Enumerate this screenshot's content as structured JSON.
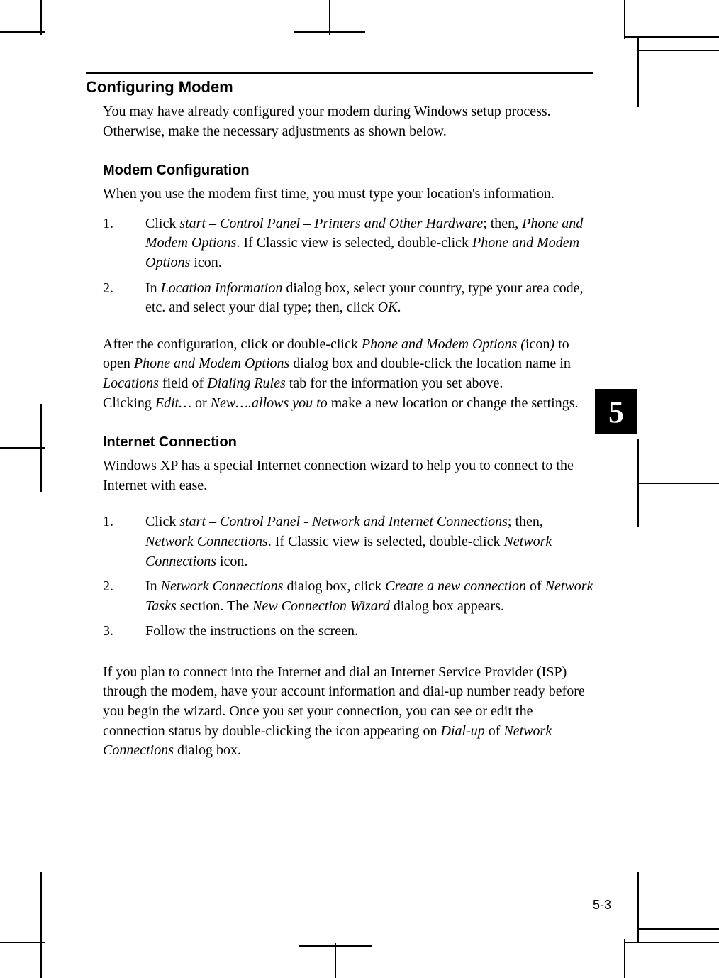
{
  "chapter_tab": "5",
  "page_number": "5-3",
  "h1": "Configuring Modem",
  "intro": "You may have already configured your modem during Windows setup process. Otherwise, make the necessary adjustments as shown below.",
  "sections": {
    "modem": {
      "title": "Modem Configuration",
      "lead": "When you use the modem first time, you must type your location's information.",
      "steps": [
        {
          "num": "1.",
          "html": "Click <i>start – Control Panel – Printers and Other Hardware</i>; then, <i>Phone and Modem Options</i>. If Classic view is selected, double-click <i>Phone and Modem Options</i> icon."
        },
        {
          "num": "2.",
          "html": "In <i>Location Information</i> dialog box, select your country, type your area code, etc. and select your dial type; then, click <i>OK</i>."
        }
      ],
      "after_html": "After the configuration, click or double-click <i>Phone and Modem Options (</i>icon<i>)</i> to open <i>Phone and Modem Options</i> dialog box and double-click the location name in <i>Locations</i> field of <i>Dialing Rules</i> tab for the information you set above.<br>Clicking <i>Edit…</i> or <i>New….allows you to</i> make a new location or change the settings."
    },
    "internet": {
      "title": "Internet Connection",
      "lead": "Windows XP has a special Internet connection wizard to help you to connect to the Internet with ease.",
      "steps": [
        {
          "num": "1.",
          "html": "Click <i>start – Control Panel - Network and Internet Connections</i>; then, <i>Network Connections</i>. If Classic view is selected, double-click <i>Network Connections</i> icon."
        },
        {
          "num": "2.",
          "html": "In <i>Network Connections</i> dialog box, click <i>Create a new connection</i> of <i>Network Tasks</i> section. The <i>New Connection Wizard</i> dialog box appears."
        },
        {
          "num": "3.",
          "html": "Follow the instructions on the screen."
        }
      ],
      "after_html": "If you plan to connect into the Internet and dial an Internet Service Provider (ISP) through the modem, have your account information and dial-up number ready before you begin the wizard. Once you set your connection, you can see or edit the connection status by double-clicking the icon appearing on <i>Dial-up</i> of <i>Network Connections</i> dialog box."
    }
  }
}
